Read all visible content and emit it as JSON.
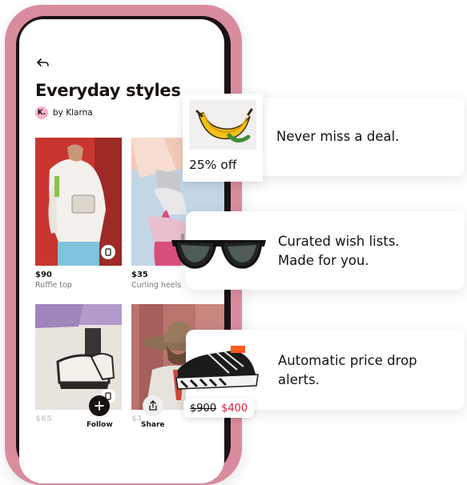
{
  "phone": {
    "title": "Everyday styles",
    "badge_letter": "K.",
    "byline": "by Klarna",
    "products": [
      {
        "price": "$90",
        "name": "Ruffle top"
      },
      {
        "price": "$35",
        "name": "Curling heels"
      },
      {
        "price": "$65",
        "name": ""
      },
      {
        "price": "$1",
        "name": ""
      }
    ],
    "actions": {
      "follow": "Follow",
      "share": "Share"
    }
  },
  "features": [
    {
      "text": "Never miss a deal.",
      "badge": "25% off"
    },
    {
      "line1": "Curated wish lists.",
      "line2": "Made for you."
    },
    {
      "line1": "Automatic price drop",
      "line2": "alerts.",
      "old_price": "$900",
      "new_price": "$400"
    }
  ],
  "colors": {
    "phone_case": "#d98c9e",
    "accent_pink": "#ffb3c7",
    "price_drop": "#e11b3b"
  }
}
